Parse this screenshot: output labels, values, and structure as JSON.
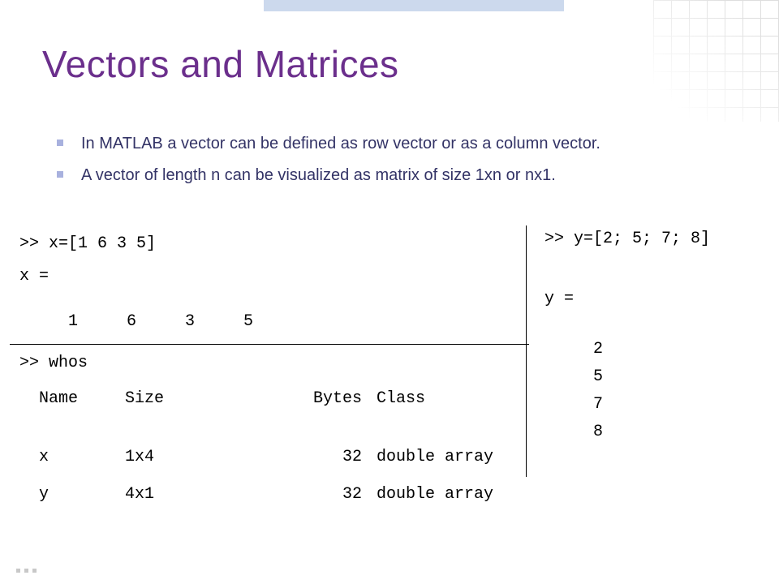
{
  "title": "Vectors and Matrices",
  "bullets": [
    "In MATLAB a vector can be defined as row vector or as a column vector.",
    "A vector of length n can be visualized as matrix of size 1xn or nx1."
  ],
  "left": {
    "cmd1": ">> x=[1 6 3 5]",
    "echo1": "x =",
    "row1": "     1     6     3     5",
    "cmd2": ">> whos",
    "headers": {
      "name": "  Name",
      "size": "Size",
      "bytes": "Bytes",
      "class": "Class"
    },
    "rows": [
      {
        "name": "  x",
        "size": "1x4",
        "bytes": "32",
        "class": "double array"
      },
      {
        "name": "  y",
        "size": "4x1",
        "bytes": "32",
        "class": "double array"
      }
    ]
  },
  "right": {
    "cmd1": ">> y=[2; 5; 7; 8]",
    "echo1": "y =",
    "vals": [
      "     2",
      "     5",
      "     7",
      "     8"
    ]
  }
}
